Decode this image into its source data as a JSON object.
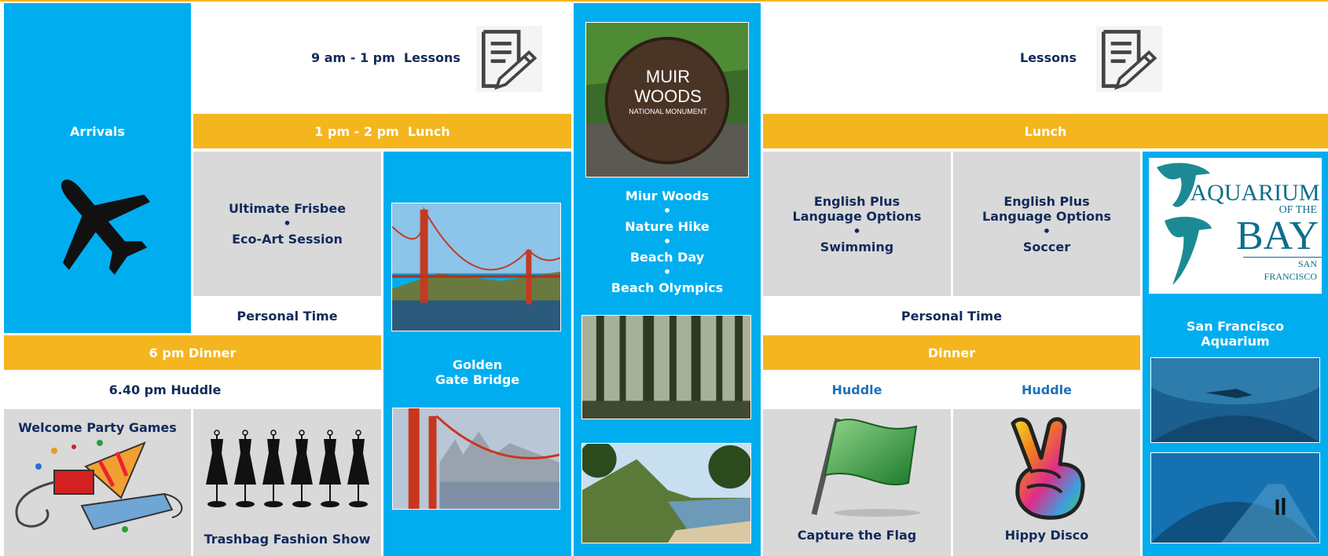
{
  "day1": {
    "arrivals": "Arrivals",
    "lessons": "9 am - 1 pm  Lessons",
    "lunch": "1 pm - 2 pm  Lunch",
    "afternoon": {
      "line1": "Ultimate Frisbee",
      "dot": "•",
      "line2": "Eco-Art Session"
    },
    "personal_time": "Personal Time",
    "golden_gate": {
      "line1": "Golden",
      "line2": "Gate Bridge"
    },
    "dinner": "6 pm Dinner",
    "huddle": "6.40 pm Huddle",
    "evening1": "Welcome Party Games",
    "evening2": "Trashbag Fashion Show"
  },
  "day2": {
    "sign": {
      "line1": "MUIR",
      "line2": "WOODS",
      "line3": "NATIONAL MONUMENT"
    },
    "activities": [
      "Miur Woods",
      "•",
      "Nature Hike",
      "•",
      "Beach Day",
      "•",
      "Beach Olympics"
    ]
  },
  "day3": {
    "lessons": "Lessons",
    "lunch": "Lunch",
    "col1": {
      "line1": "English Plus",
      "line2": "Language Options",
      "dot": "•",
      "line3": "Swimming"
    },
    "col2": {
      "line1": "English Plus",
      "line2": "Language Options",
      "dot": "•",
      "line3": "Soccer"
    },
    "personal_time": "Personal Time",
    "dinner": "Dinner",
    "huddle1": "Huddle",
    "huddle2": "Huddle",
    "evening1": "Capture the Flag",
    "evening2": "Hippy Disco",
    "aquarium_logo": {
      "line1": "AQUARIUM",
      "line2": "OF THE",
      "line3": "BAY",
      "line4": "SAN FRANCISCO"
    },
    "aquarium": {
      "line1": "San Francisco",
      "line2": "Aquarium"
    }
  },
  "colors": {
    "blue": "#00AEEF",
    "gold": "#F5B51E",
    "grey": "#D9D9D9",
    "navy": "#112A5B"
  }
}
